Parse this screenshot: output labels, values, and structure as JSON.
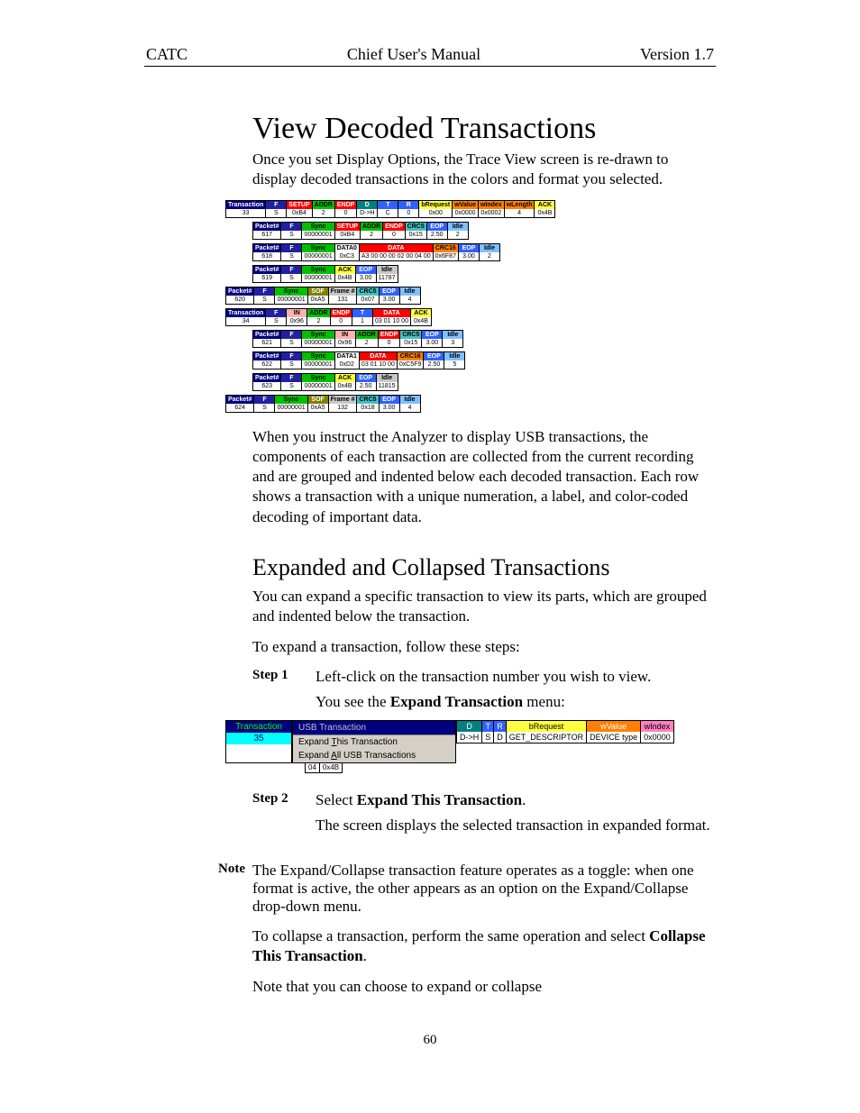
{
  "header": {
    "left": "CATC",
    "center": "Chief User's Manual",
    "right": "Version 1.7"
  },
  "h1": "View Decoded Transactions",
  "p1": "Once you set Display Options, the Trace View screen is re-drawn to display decoded transactions in the colors and format you selected.",
  "p2": "When you instruct the Analyzer to display USB transactions, the components of each transaction are collected from the current recording and are grouped and indented below each decoded transaction. Each row shows a transaction with a unique numeration, a label, and color-coded decoding of important data.",
  "h2": "Expanded and Collapsed Transactions",
  "p3": "You can expand a specific transaction to view its parts, which are grouped and indented below the transaction.",
  "p4": "To expand a transaction, follow these steps:",
  "step1_label": "Step 1",
  "step1_text": "Left-click on the transaction number you wish to view.",
  "step1_after_a": "You see the ",
  "step1_after_b": "Expand Transaction",
  "step1_after_c": " menu:",
  "step2_label": "Step 2",
  "step2_a": "Select ",
  "step2_b": "Expand This Transaction",
  "step2_c": ".",
  "step2_after": "The screen displays the selected transaction in expanded format.",
  "note_label": "Note",
  "note_text": "The Expand/Collapse transaction feature operates as a toggle: when one format is active, the other appears as an option on the Expand/Collapse drop-down menu.",
  "p5_a": "To collapse a transaction, perform the same operation and select ",
  "p5_b": "Collapse This Transaction",
  "p5_c": ".",
  "p6": "Note that you can choose to expand or collapse",
  "page_number": "60",
  "fig1": {
    "rows": [
      {
        "indent": 0,
        "cells": [
          {
            "c": "c-navy",
            "h": "Transaction",
            "v": "33"
          },
          {
            "c": "c-navy2 fs",
            "h": "F",
            "v": "S"
          },
          {
            "c": "c-red",
            "h": "SETUP",
            "v": "0xB4"
          },
          {
            "c": "c-green",
            "h": "ADDR",
            "v": "2"
          },
          {
            "c": "c-red",
            "h": "ENDP",
            "v": "0"
          },
          {
            "c": "c-teal",
            "h": "D",
            "v": "D->H"
          },
          {
            "c": "c-blue",
            "h": "T",
            "v": "C"
          },
          {
            "c": "c-blue",
            "h": "R",
            "v": "0"
          },
          {
            "c": "c-yellow",
            "h": "bRequest",
            "v": "0x00"
          },
          {
            "c": "c-orange",
            "h": "wValue",
            "v": "0x0000"
          },
          {
            "c": "c-orange",
            "h": "wIndex",
            "v": "0x0002"
          },
          {
            "c": "c-orange",
            "h": "wLength",
            "v": "4"
          },
          {
            "c": "c-yellow",
            "h": "ACK",
            "v": "0x4B"
          }
        ]
      },
      {
        "indent": 1,
        "cells": [
          {
            "c": "c-navy",
            "h": "Packet#",
            "v": "617"
          },
          {
            "c": "c-navy2 fs",
            "h": "F",
            "v": "S"
          },
          {
            "c": "c-green",
            "h": "Sync",
            "v": "00000001"
          },
          {
            "c": "c-red",
            "h": "SETUP",
            "v": "0xB4"
          },
          {
            "c": "c-green",
            "h": "ADDR",
            "v": "2"
          },
          {
            "c": "c-red",
            "h": "ENDP",
            "v": "0"
          },
          {
            "c": "c-cyan",
            "h": "CRC5",
            "v": "0x15"
          },
          {
            "c": "c-blue",
            "h": "EOP",
            "v": "2.50"
          },
          {
            "c": "c-ltblue",
            "h": "Idle",
            "v": "2"
          }
        ]
      },
      {
        "indent": 1,
        "cells": [
          {
            "c": "c-navy",
            "h": "Packet#",
            "v": "618"
          },
          {
            "c": "c-navy2 fs",
            "h": "F",
            "v": "S"
          },
          {
            "c": "c-green",
            "h": "Sync",
            "v": "00000001"
          },
          {
            "c": "c-white",
            "h": "DATA0",
            "v": "0xC3"
          },
          {
            "c": "c-red",
            "h": "DATA",
            "v": "A3 00 00 00 02 00 04 00"
          },
          {
            "c": "c-orange",
            "h": "CRC16",
            "v": "0x6F87"
          },
          {
            "c": "c-blue",
            "h": "EOP",
            "v": "3.00"
          },
          {
            "c": "c-ltblue",
            "h": "Idle",
            "v": "2"
          }
        ]
      },
      {
        "indent": 1,
        "cells": [
          {
            "c": "c-navy",
            "h": "Packet#",
            "v": "619"
          },
          {
            "c": "c-navy2 fs",
            "h": "F",
            "v": "S"
          },
          {
            "c": "c-green",
            "h": "Sync",
            "v": "00000001"
          },
          {
            "c": "c-yellow",
            "h": "ACK",
            "v": "0x4B"
          },
          {
            "c": "c-blue",
            "h": "EOP",
            "v": "3.00"
          },
          {
            "c": "c-ltgry",
            "h": "Idle",
            "v": "11787"
          }
        ]
      },
      {
        "indent": 0,
        "cells": [
          {
            "c": "c-navy",
            "h": "Packet#",
            "v": "620"
          },
          {
            "c": "c-navy2 fs",
            "h": "F",
            "v": "S"
          },
          {
            "c": "c-green",
            "h": "Sync",
            "v": "00000001"
          },
          {
            "c": "c-olive",
            "h": "SOF",
            "v": "0xA5"
          },
          {
            "c": "c-ltgry",
            "h": "Frame #",
            "v": "131"
          },
          {
            "c": "c-cyan",
            "h": "CRC5",
            "v": "0x07"
          },
          {
            "c": "c-blue",
            "h": "EOP",
            "v": "3.00"
          },
          {
            "c": "c-ltblue",
            "h": "Idle",
            "v": "4"
          }
        ]
      },
      {
        "indent": 0,
        "cells": [
          {
            "c": "c-navy",
            "h": "Transaction",
            "v": "34"
          },
          {
            "c": "c-navy2 fs",
            "h": "F",
            "v": "S"
          },
          {
            "c": "c-pink",
            "h": "IN",
            "v": "0x96"
          },
          {
            "c": "c-green",
            "h": "ADDR",
            "v": "2"
          },
          {
            "c": "c-red",
            "h": "ENDP",
            "v": "0"
          },
          {
            "c": "c-blue",
            "h": "T",
            "v": "1"
          },
          {
            "c": "c-red",
            "h": "DATA",
            "v": "03 01 10 00"
          },
          {
            "c": "c-yellow",
            "h": "ACK",
            "v": "0x4B"
          }
        ]
      },
      {
        "indent": 1,
        "cells": [
          {
            "c": "c-navy",
            "h": "Packet#",
            "v": "621"
          },
          {
            "c": "c-navy2 fs",
            "h": "F",
            "v": "S"
          },
          {
            "c": "c-green",
            "h": "Sync",
            "v": "00000001"
          },
          {
            "c": "c-pink",
            "h": "IN",
            "v": "0x96"
          },
          {
            "c": "c-green",
            "h": "ADDR",
            "v": "2"
          },
          {
            "c": "c-red",
            "h": "ENDP",
            "v": "0"
          },
          {
            "c": "c-cyan",
            "h": "CRC5",
            "v": "0x15"
          },
          {
            "c": "c-blue",
            "h": "EOP",
            "v": "3.00"
          },
          {
            "c": "c-ltblue",
            "h": "Idle",
            "v": "3"
          }
        ]
      },
      {
        "indent": 1,
        "cells": [
          {
            "c": "c-navy",
            "h": "Packet#",
            "v": "622"
          },
          {
            "c": "c-navy2 fs",
            "h": "F",
            "v": "S"
          },
          {
            "c": "c-green",
            "h": "Sync",
            "v": "00000001"
          },
          {
            "c": "c-white",
            "h": "DATA1",
            "v": "0xD2"
          },
          {
            "c": "c-red",
            "h": "DATA",
            "v": "03 01 10 00"
          },
          {
            "c": "c-orange",
            "h": "CRC16",
            "v": "0xC5F9"
          },
          {
            "c": "c-blue",
            "h": "EOP",
            "v": "2.50"
          },
          {
            "c": "c-ltblue",
            "h": "Idle",
            "v": "5"
          }
        ]
      },
      {
        "indent": 1,
        "cells": [
          {
            "c": "c-navy",
            "h": "Packet#",
            "v": "623"
          },
          {
            "c": "c-navy2 fs",
            "h": "F",
            "v": "S"
          },
          {
            "c": "c-green",
            "h": "Sync",
            "v": "00000001"
          },
          {
            "c": "c-yellow",
            "h": "ACK",
            "v": "0x4B"
          },
          {
            "c": "c-blue",
            "h": "EOP",
            "v": "2.50"
          },
          {
            "c": "c-ltgry",
            "h": "Idle",
            "v": "11815"
          }
        ]
      },
      {
        "indent": 0,
        "cells": [
          {
            "c": "c-navy",
            "h": "Packet#",
            "v": "624"
          },
          {
            "c": "c-navy2 fs",
            "h": "F",
            "v": "S"
          },
          {
            "c": "c-green",
            "h": "Sync",
            "v": "00000001"
          },
          {
            "c": "c-olive",
            "h": "SOF",
            "v": "0xA5"
          },
          {
            "c": "c-ltgry",
            "h": "Frame #",
            "v": "132"
          },
          {
            "c": "c-cyan",
            "h": "CRC5",
            "v": "0x18"
          },
          {
            "c": "c-blue",
            "h": "EOP",
            "v": "3.00"
          },
          {
            "c": "c-ltblue",
            "h": "Idle",
            "v": "4"
          }
        ]
      }
    ]
  },
  "fig2": {
    "trans_h": "Transaction",
    "trans_v": "35",
    "menu_title": "USB Transaction",
    "menu_item1": "Expand This Transaction",
    "menu_item2": "Expand All USB Transactions",
    "fields": [
      {
        "c": "fc-teal",
        "h": "D",
        "v": "D->H"
      },
      {
        "c": "fc-blue",
        "h": "T",
        "v": "S"
      },
      {
        "c": "fc-blue",
        "h": "R",
        "v": "D"
      },
      {
        "c": "fc-yel",
        "h": "bRequest",
        "v": "GET_DESCRIPTOR"
      },
      {
        "c": "fc-org",
        "h": "wValue",
        "v": "DEVICE type"
      },
      {
        "c": "fc-pink",
        "h": "wIndex",
        "v": "0x0000"
      }
    ],
    "stub": [
      {
        "c": "fc-teal",
        "h": "",
        "v": "04"
      },
      {
        "c": "fc-teal",
        "h": "",
        "v": "0x4B"
      }
    ]
  }
}
